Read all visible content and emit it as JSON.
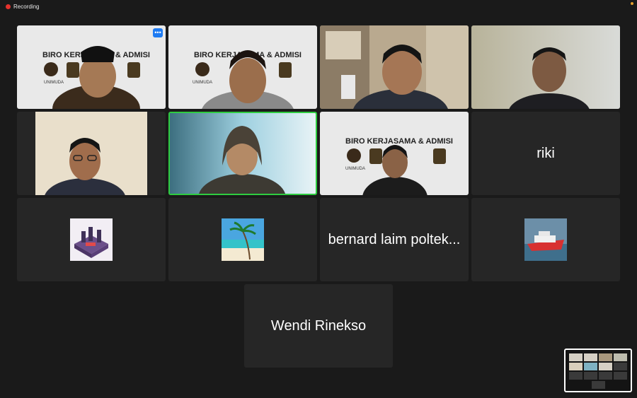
{
  "recording_label": "Recording",
  "colors": {
    "recording": "#e5322d",
    "active_speaker": "#2ecc40",
    "more_button": "#1e7bf2",
    "tile": "#262626",
    "background": "#1a1a1a"
  },
  "banner_text": "BIRO KERJASAMA & ADMISI",
  "banner_logo_text": "UNIMUDA",
  "name_tiles": {
    "riki": "riki",
    "bernard": "bernard laim poltek...",
    "wendi": "Wendi Rinekso"
  },
  "icons": {
    "more": "more-options-icon",
    "record": "record-dot-icon"
  }
}
